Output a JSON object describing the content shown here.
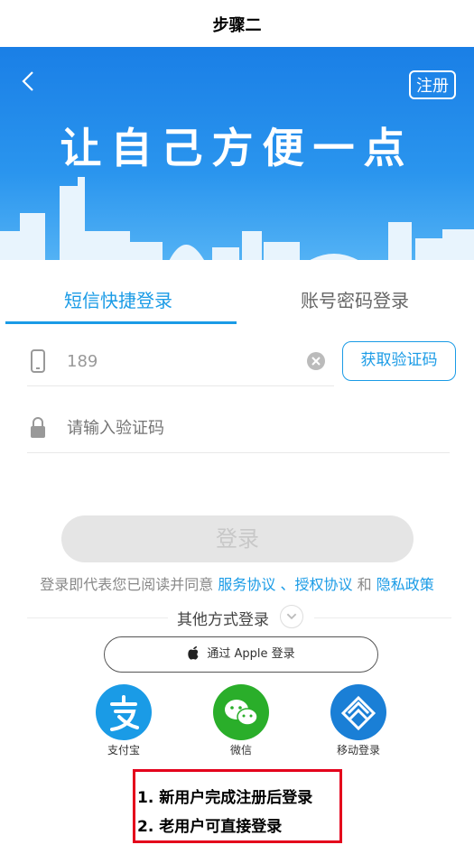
{
  "step_title": "步骤二",
  "banner": {
    "register_label": "注册",
    "slogan": "让自己方便一点",
    "color_top": "#1a7fe6",
    "color_bottom": "#5ab7f6"
  },
  "tabs": [
    {
      "label": "短信快捷登录",
      "active": true
    },
    {
      "label": "账号密码登录",
      "active": false
    }
  ],
  "phone_field": {
    "value": "189",
    "icon": "phone-icon"
  },
  "get_code_label": "获取验证码",
  "code_field": {
    "placeholder": "请输入验证码",
    "icon": "lock-icon"
  },
  "login_label": "登录",
  "agreement": {
    "prefix": "登录即代表您已阅读并同意",
    "service": "服务协议",
    "sep": "、",
    "auth": "授权协议",
    "and": "和",
    "privacy": "隐私政策"
  },
  "other_login_label": "其他方式登录",
  "apple_label": "通过 Apple 登录",
  "sso": [
    {
      "label": "支付宝",
      "icon": "alipay-icon",
      "color": "#1a9be6"
    },
    {
      "label": "微信",
      "icon": "wechat-icon",
      "color": "#2aae2a"
    },
    {
      "label": "移动登录",
      "icon": "china-mobile-icon",
      "color": "#1a7fd6"
    }
  ],
  "notes": [
    "1. 新用户完成注册后登录",
    "2. 老用户可直接登录"
  ],
  "accent_color": "#1a9be6",
  "note_border_color": "#e4001b"
}
